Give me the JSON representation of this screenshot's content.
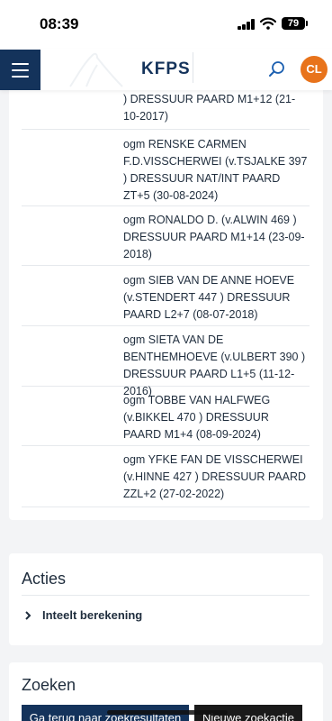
{
  "status_bar": {
    "time": "08:39",
    "battery": "79"
  },
  "header": {
    "logo": "KFPS",
    "avatar_initials": "CL",
    "menu_icon": "hamburger-icon",
    "search_icon": "search-icon"
  },
  "results": [
    "ogm RENSKE CARMEN F.D.VISSCHERWEI (v.TSJALKE 397 ) DRESSUUR NAT/INT PAARD ZT+5 (30-08-2024)",
    "ogm RONALDO D. (v.ALWIN 469 ) DRESSUUR PAARD M1+14 (23-09-2018)",
    "ogm SIEB VAN DE ANNE HOEVE (v.STENDERT 447 ) DRESSUUR PAARD L2+7 (08-07-2018)",
    "ogm SIETA VAN DE BENTHEMHOEVE (v.ULBERT 390 ) DRESSUUR PAARD L1+5 (11-12-2016)",
    "ogm TOBBE VAN HALFWEG (v.BIKKEL 470 ) DRESSUUR PAARD M1+4 (08-09-2024)",
    "ogm YFKE FAN DE VISSCHERWEI (v.HINNE 427 ) DRESSUUR PAARD ZZL+2 (27-02-2022)"
  ],
  "results_partial_top": ") DRESSUUR PAARD M1+12 (21-10-2017)",
  "actions": {
    "title": "Acties",
    "items": [
      "Inteelt berekening"
    ]
  },
  "search": {
    "title": "Zoeken",
    "back_label": "Ga terug naar zoekresultaten",
    "new_label": "Nieuwe zoekactie"
  },
  "colors": {
    "navy": "#14335b",
    "avatar": "#e8731b",
    "page_bg": "#f3f4f6"
  }
}
